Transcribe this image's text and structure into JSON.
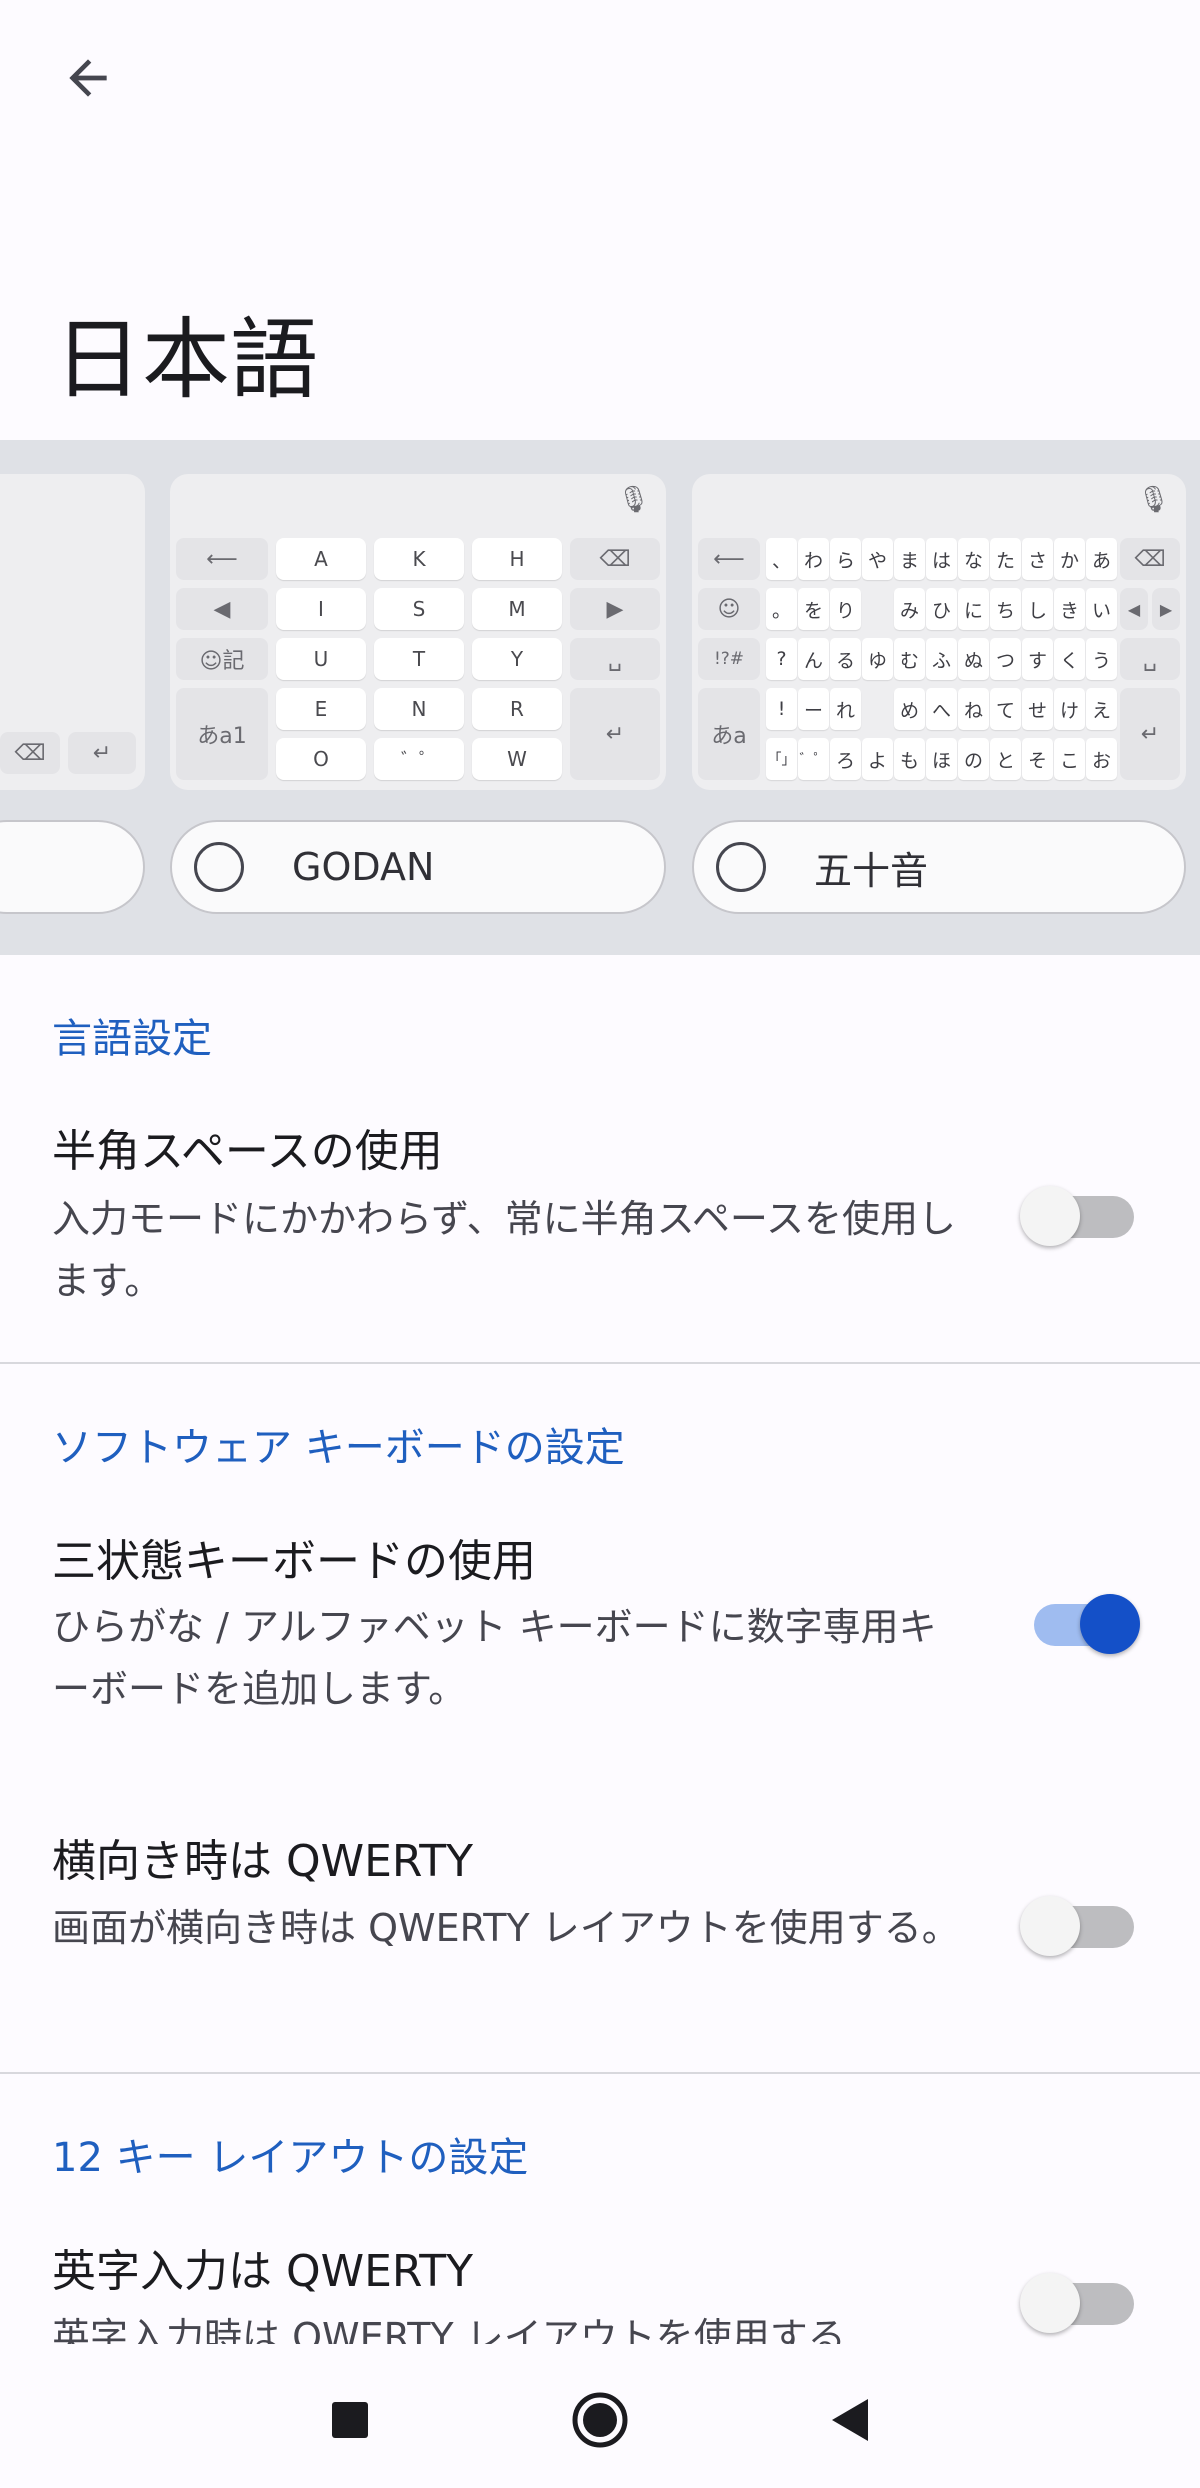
{
  "header": {
    "back_icon": "arrow-back-icon",
    "title": "日本語"
  },
  "keyboards": {
    "godan": {
      "label": "GODAN",
      "letters": [
        "A",
        "K",
        "H",
        "I",
        "S",
        "M",
        "U",
        "T",
        "Y",
        "E",
        "N",
        "R",
        "O",
        "W"
      ],
      "fn_labels": {
        "emoji": "☺記",
        "mode": "あa1"
      }
    },
    "gojuon": {
      "label": "五十音",
      "rows": [
        [
          "、",
          "わ",
          "ら",
          "や",
          "ま",
          "は",
          "な",
          "た",
          "さ",
          "か",
          "あ"
        ],
        [
          "。",
          "を",
          "り",
          "",
          "み",
          "ひ",
          "に",
          "ち",
          "し",
          "き",
          "い"
        ],
        [
          "?",
          "ん",
          "る",
          "ゆ",
          "む",
          "ふ",
          "ぬ",
          "つ",
          "す",
          "く",
          "う"
        ],
        [
          "!",
          "ー",
          "れ",
          "",
          "め",
          "へ",
          "ね",
          "て",
          "せ",
          "け",
          "え"
        ],
        [
          "「」",
          "゛゜",
          "ろ",
          "よ",
          "も",
          "ほ",
          "の",
          "と",
          "そ",
          "こ",
          "お"
        ]
      ],
      "fn_labels": {
        "symbols": "!?#",
        "mode": "あa"
      }
    }
  },
  "sections": {
    "language": {
      "header": "言語設定",
      "items": [
        {
          "title": "半角スペースの使用",
          "summary": "入力モードにかかわらず、常に半角スペースを使用します。",
          "enabled": false
        }
      ]
    },
    "software_keyboard": {
      "header": "ソフトウェア キーボードの設定",
      "items": [
        {
          "title": "三状態キーボードの使用",
          "summary": "ひらがな / アルファベット キーボードに数字専用キーボードを追加します。",
          "enabled": true
        },
        {
          "title": "横向き時は QWERTY",
          "summary": "画面が横向き時は QWERTY レイアウトを使用する。",
          "enabled": false
        }
      ]
    },
    "twelve_key": {
      "header": "12 キー レイアウトの設定",
      "items": [
        {
          "title": "英字入力は QWERTY",
          "summary": "英字入力時は QWERTY レイアウトを使用する",
          "enabled": false
        }
      ]
    }
  },
  "colors": {
    "accent": "#1450c8",
    "section_header": "#1f5fbf",
    "toggle_on_track": "#9fbcf0"
  },
  "nav_bar": {
    "icons": [
      "recents-square-icon",
      "home-circle-icon",
      "back-triangle-icon"
    ]
  }
}
